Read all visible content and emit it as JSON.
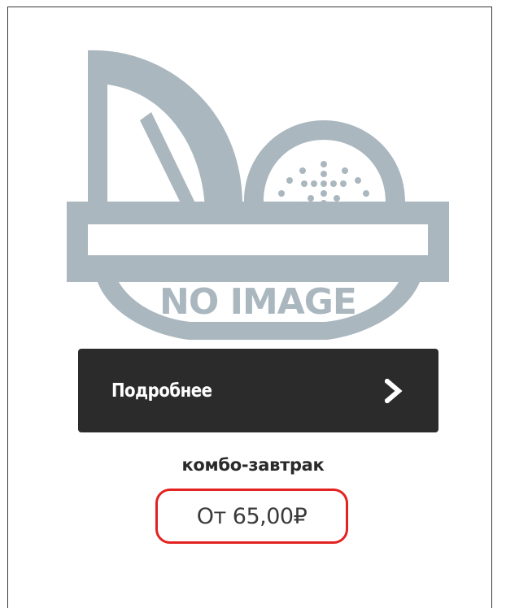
{
  "product_card": {
    "image_placeholder_text": "NO IMAGE",
    "placeholder_color": "#aab7bf",
    "details_button_label": "Подробнее",
    "details_button_icon": "chevron-right-icon",
    "product_name": "комбо-завтрак",
    "price": "От 65,00₽",
    "price_highlight_color": "#e32222"
  }
}
